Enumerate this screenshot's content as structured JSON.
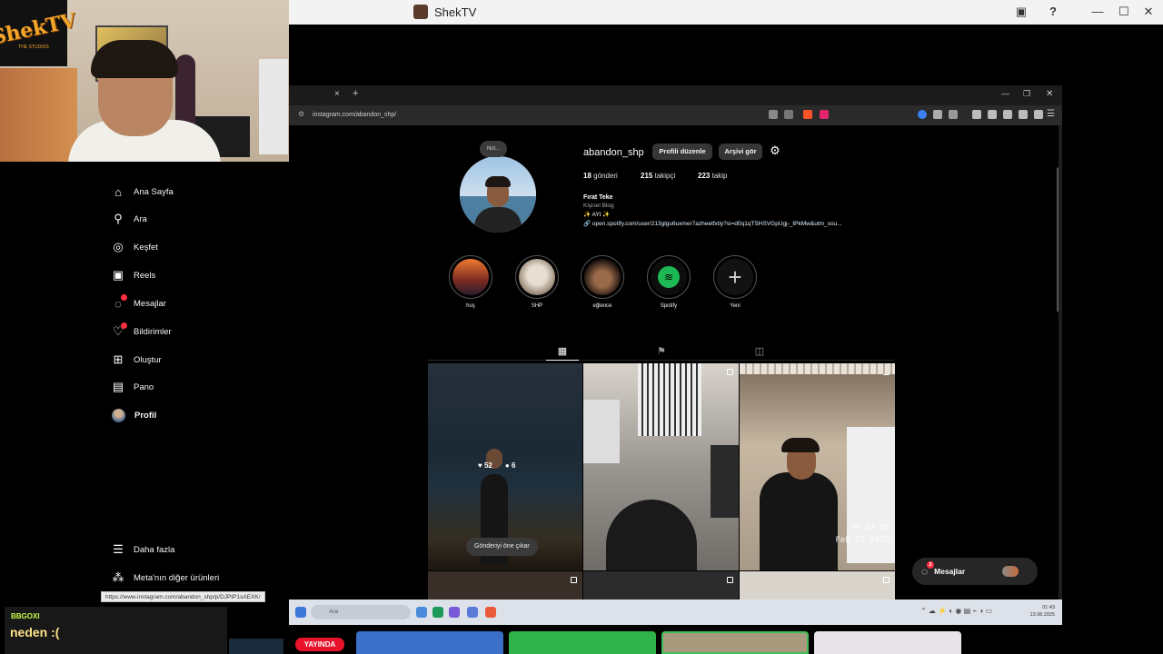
{
  "host": {
    "app_title": "ShekTV",
    "logo_text": "ShekTV",
    "logo_sub": "THE STUDIOS"
  },
  "browser": {
    "new_tab": "+",
    "tab_close": "×",
    "url": "instagram.com/abandon_shp/",
    "status_url": "https://www.instagram.com/abandon_shp/p/DJPtP1sAEXK/"
  },
  "nav": {
    "items": [
      {
        "label": "Ana Sayfa",
        "icon": "home-icon",
        "glyph": "⌂"
      },
      {
        "label": "Ara",
        "icon": "search-icon",
        "glyph": "⚲"
      },
      {
        "label": "Keşfet",
        "icon": "compass-icon",
        "glyph": "◎"
      },
      {
        "label": "Reels",
        "icon": "reels-icon",
        "glyph": "▣"
      },
      {
        "label": "Mesajlar",
        "icon": "messenger-icon",
        "glyph": "◌"
      },
      {
        "label": "Bildirimler",
        "icon": "heart-icon",
        "glyph": "♡"
      },
      {
        "label": "Oluştur",
        "icon": "plus-square-icon",
        "glyph": "⊞"
      },
      {
        "label": "Pano",
        "icon": "dashboard-icon",
        "glyph": "▤"
      },
      {
        "label": "Profil",
        "icon": "avatar-icon",
        "glyph": ""
      }
    ],
    "more": {
      "label": "Daha fazla",
      "glyph": "☰"
    },
    "meta": {
      "label": "Meta'nın diğer ürünleri",
      "glyph": "⁂"
    }
  },
  "profile": {
    "note": "Not...",
    "username": "abandon_shp",
    "edit_button": "Profili düzenle",
    "archive_button": "Arşivi gör",
    "posts_count": "18",
    "posts_label": "gönderi",
    "followers_count": "215",
    "followers_label": "takipçi",
    "following_count": "223",
    "following_label": "takip",
    "full_name": "Fırat Teke",
    "category": "Kişisel Blog",
    "bio": "✨ AYI ✨",
    "link": "open.spotify.com/user/213glgu6uxmer7azheetfxtiy?si=d0q1qTSHSVGpUgj-_tPkMw&utm_sou..."
  },
  "highlights": [
    {
      "label": "huş",
      "colors": [
        "#e0642a",
        "#2b1d2e"
      ]
    },
    {
      "label": "SHP",
      "colors": [
        "#d9d2c8",
        "#8c7b6a"
      ]
    },
    {
      "label": "eğlence",
      "colors": [
        "#6b4a3a",
        "#1e1410"
      ]
    },
    {
      "label": "Spotify",
      "colors": [
        "#1db954",
        "#0d0d0d"
      ]
    },
    {
      "label": "Yeni",
      "colors": [
        "#121212",
        "#121212"
      ]
    }
  ],
  "tabs": {
    "posts": "▦",
    "saved": "⚑",
    "tagged": "◫"
  },
  "posts": {
    "likes": "52",
    "comments": "6",
    "pin_toast": "Gönderiyi öne çıkar",
    "watermark_time": "PM 04 05",
    "watermark_date": "Feb 15 2025"
  },
  "messages_pill": {
    "label": "Mesajlar",
    "badge": "2"
  },
  "taskbar": {
    "search_placeholder": "Ara",
    "time": "01:43",
    "date": "13.08.2025"
  },
  "chat": {
    "username": "BBGOXI",
    "message": "neden :("
  },
  "live_badge": "YAYINDA"
}
